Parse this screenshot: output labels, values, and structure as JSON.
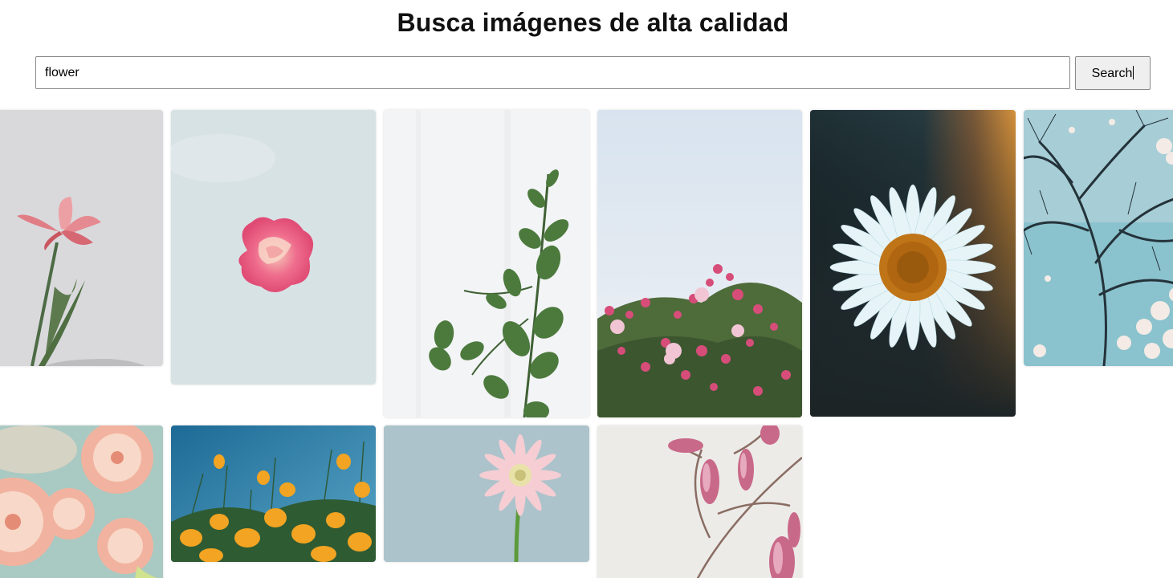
{
  "header": {
    "title": "Busca imágenes de alta calidad"
  },
  "search": {
    "value": "flower",
    "button_label": "Search"
  },
  "gallery": {
    "images": [
      {
        "subject": "pink lily on grey background",
        "icon": "photo-pink-lily"
      },
      {
        "subject": "pink rose against pale sky",
        "icon": "photo-pink-rose"
      },
      {
        "subject": "eucalyptus branch on white",
        "icon": "photo-eucalyptus"
      },
      {
        "subject": "pink blossoms against sky",
        "icon": "photo-pink-blossoms"
      },
      {
        "subject": "white daisy on dark background",
        "icon": "photo-daisy"
      },
      {
        "subject": "cherry blossom branches against blue sky",
        "icon": "photo-cherry-tree"
      },
      {
        "subject": "peach dahlias",
        "icon": "photo-dahlias"
      },
      {
        "subject": "orange poppies under blue sky",
        "icon": "photo-poppies"
      },
      {
        "subject": "pink gerbera on blue background",
        "icon": "photo-gerbera"
      },
      {
        "subject": "magnolia buds on branch",
        "icon": "photo-magnolia"
      }
    ]
  },
  "colors": {
    "button_bg": "#efefef",
    "border": "#8a8a8a",
    "title": "#111111"
  }
}
